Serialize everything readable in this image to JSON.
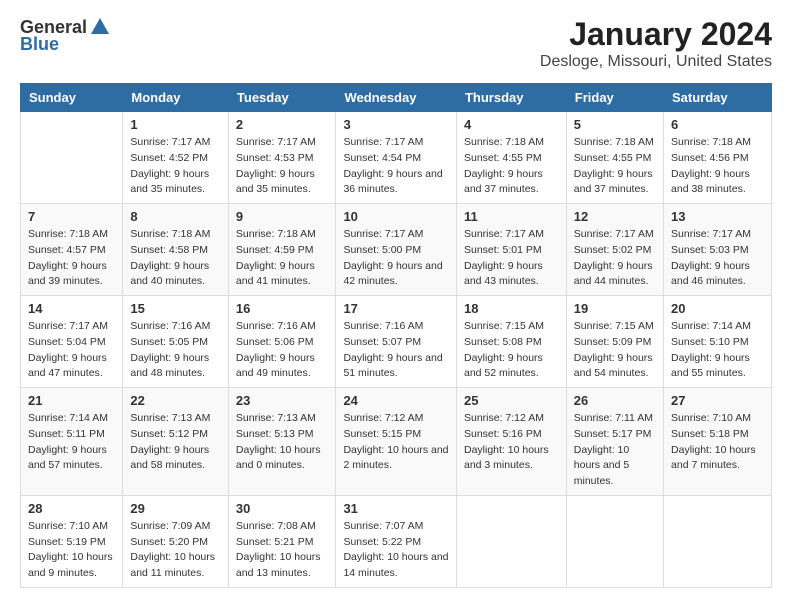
{
  "logo": {
    "general": "General",
    "blue": "Blue"
  },
  "title": "January 2024",
  "subtitle": "Desloge, Missouri, United States",
  "headers": [
    "Sunday",
    "Monday",
    "Tuesday",
    "Wednesday",
    "Thursday",
    "Friday",
    "Saturday"
  ],
  "weeks": [
    [
      {
        "day": "",
        "sunrise": "",
        "sunset": "",
        "daylight": ""
      },
      {
        "day": "1",
        "sunrise": "Sunrise: 7:17 AM",
        "sunset": "Sunset: 4:52 PM",
        "daylight": "Daylight: 9 hours and 35 minutes."
      },
      {
        "day": "2",
        "sunrise": "Sunrise: 7:17 AM",
        "sunset": "Sunset: 4:53 PM",
        "daylight": "Daylight: 9 hours and 35 minutes."
      },
      {
        "day": "3",
        "sunrise": "Sunrise: 7:17 AM",
        "sunset": "Sunset: 4:54 PM",
        "daylight": "Daylight: 9 hours and 36 minutes."
      },
      {
        "day": "4",
        "sunrise": "Sunrise: 7:18 AM",
        "sunset": "Sunset: 4:55 PM",
        "daylight": "Daylight: 9 hours and 37 minutes."
      },
      {
        "day": "5",
        "sunrise": "Sunrise: 7:18 AM",
        "sunset": "Sunset: 4:55 PM",
        "daylight": "Daylight: 9 hours and 37 minutes."
      },
      {
        "day": "6",
        "sunrise": "Sunrise: 7:18 AM",
        "sunset": "Sunset: 4:56 PM",
        "daylight": "Daylight: 9 hours and 38 minutes."
      }
    ],
    [
      {
        "day": "7",
        "sunrise": "Sunrise: 7:18 AM",
        "sunset": "Sunset: 4:57 PM",
        "daylight": "Daylight: 9 hours and 39 minutes."
      },
      {
        "day": "8",
        "sunrise": "Sunrise: 7:18 AM",
        "sunset": "Sunset: 4:58 PM",
        "daylight": "Daylight: 9 hours and 40 minutes."
      },
      {
        "day": "9",
        "sunrise": "Sunrise: 7:18 AM",
        "sunset": "Sunset: 4:59 PM",
        "daylight": "Daylight: 9 hours and 41 minutes."
      },
      {
        "day": "10",
        "sunrise": "Sunrise: 7:17 AM",
        "sunset": "Sunset: 5:00 PM",
        "daylight": "Daylight: 9 hours and 42 minutes."
      },
      {
        "day": "11",
        "sunrise": "Sunrise: 7:17 AM",
        "sunset": "Sunset: 5:01 PM",
        "daylight": "Daylight: 9 hours and 43 minutes."
      },
      {
        "day": "12",
        "sunrise": "Sunrise: 7:17 AM",
        "sunset": "Sunset: 5:02 PM",
        "daylight": "Daylight: 9 hours and 44 minutes."
      },
      {
        "day": "13",
        "sunrise": "Sunrise: 7:17 AM",
        "sunset": "Sunset: 5:03 PM",
        "daylight": "Daylight: 9 hours and 46 minutes."
      }
    ],
    [
      {
        "day": "14",
        "sunrise": "Sunrise: 7:17 AM",
        "sunset": "Sunset: 5:04 PM",
        "daylight": "Daylight: 9 hours and 47 minutes."
      },
      {
        "day": "15",
        "sunrise": "Sunrise: 7:16 AM",
        "sunset": "Sunset: 5:05 PM",
        "daylight": "Daylight: 9 hours and 48 minutes."
      },
      {
        "day": "16",
        "sunrise": "Sunrise: 7:16 AM",
        "sunset": "Sunset: 5:06 PM",
        "daylight": "Daylight: 9 hours and 49 minutes."
      },
      {
        "day": "17",
        "sunrise": "Sunrise: 7:16 AM",
        "sunset": "Sunset: 5:07 PM",
        "daylight": "Daylight: 9 hours and 51 minutes."
      },
      {
        "day": "18",
        "sunrise": "Sunrise: 7:15 AM",
        "sunset": "Sunset: 5:08 PM",
        "daylight": "Daylight: 9 hours and 52 minutes."
      },
      {
        "day": "19",
        "sunrise": "Sunrise: 7:15 AM",
        "sunset": "Sunset: 5:09 PM",
        "daylight": "Daylight: 9 hours and 54 minutes."
      },
      {
        "day": "20",
        "sunrise": "Sunrise: 7:14 AM",
        "sunset": "Sunset: 5:10 PM",
        "daylight": "Daylight: 9 hours and 55 minutes."
      }
    ],
    [
      {
        "day": "21",
        "sunrise": "Sunrise: 7:14 AM",
        "sunset": "Sunset: 5:11 PM",
        "daylight": "Daylight: 9 hours and 57 minutes."
      },
      {
        "day": "22",
        "sunrise": "Sunrise: 7:13 AM",
        "sunset": "Sunset: 5:12 PM",
        "daylight": "Daylight: 9 hours and 58 minutes."
      },
      {
        "day": "23",
        "sunrise": "Sunrise: 7:13 AM",
        "sunset": "Sunset: 5:13 PM",
        "daylight": "Daylight: 10 hours and 0 minutes."
      },
      {
        "day": "24",
        "sunrise": "Sunrise: 7:12 AM",
        "sunset": "Sunset: 5:15 PM",
        "daylight": "Daylight: 10 hours and 2 minutes."
      },
      {
        "day": "25",
        "sunrise": "Sunrise: 7:12 AM",
        "sunset": "Sunset: 5:16 PM",
        "daylight": "Daylight: 10 hours and 3 minutes."
      },
      {
        "day": "26",
        "sunrise": "Sunrise: 7:11 AM",
        "sunset": "Sunset: 5:17 PM",
        "daylight": "Daylight: 10 hours and 5 minutes."
      },
      {
        "day": "27",
        "sunrise": "Sunrise: 7:10 AM",
        "sunset": "Sunset: 5:18 PM",
        "daylight": "Daylight: 10 hours and 7 minutes."
      }
    ],
    [
      {
        "day": "28",
        "sunrise": "Sunrise: 7:10 AM",
        "sunset": "Sunset: 5:19 PM",
        "daylight": "Daylight: 10 hours and 9 minutes."
      },
      {
        "day": "29",
        "sunrise": "Sunrise: 7:09 AM",
        "sunset": "Sunset: 5:20 PM",
        "daylight": "Daylight: 10 hours and 11 minutes."
      },
      {
        "day": "30",
        "sunrise": "Sunrise: 7:08 AM",
        "sunset": "Sunset: 5:21 PM",
        "daylight": "Daylight: 10 hours and 13 minutes."
      },
      {
        "day": "31",
        "sunrise": "Sunrise: 7:07 AM",
        "sunset": "Sunset: 5:22 PM",
        "daylight": "Daylight: 10 hours and 14 minutes."
      },
      {
        "day": "",
        "sunrise": "",
        "sunset": "",
        "daylight": ""
      },
      {
        "day": "",
        "sunrise": "",
        "sunset": "",
        "daylight": ""
      },
      {
        "day": "",
        "sunrise": "",
        "sunset": "",
        "daylight": ""
      }
    ]
  ]
}
